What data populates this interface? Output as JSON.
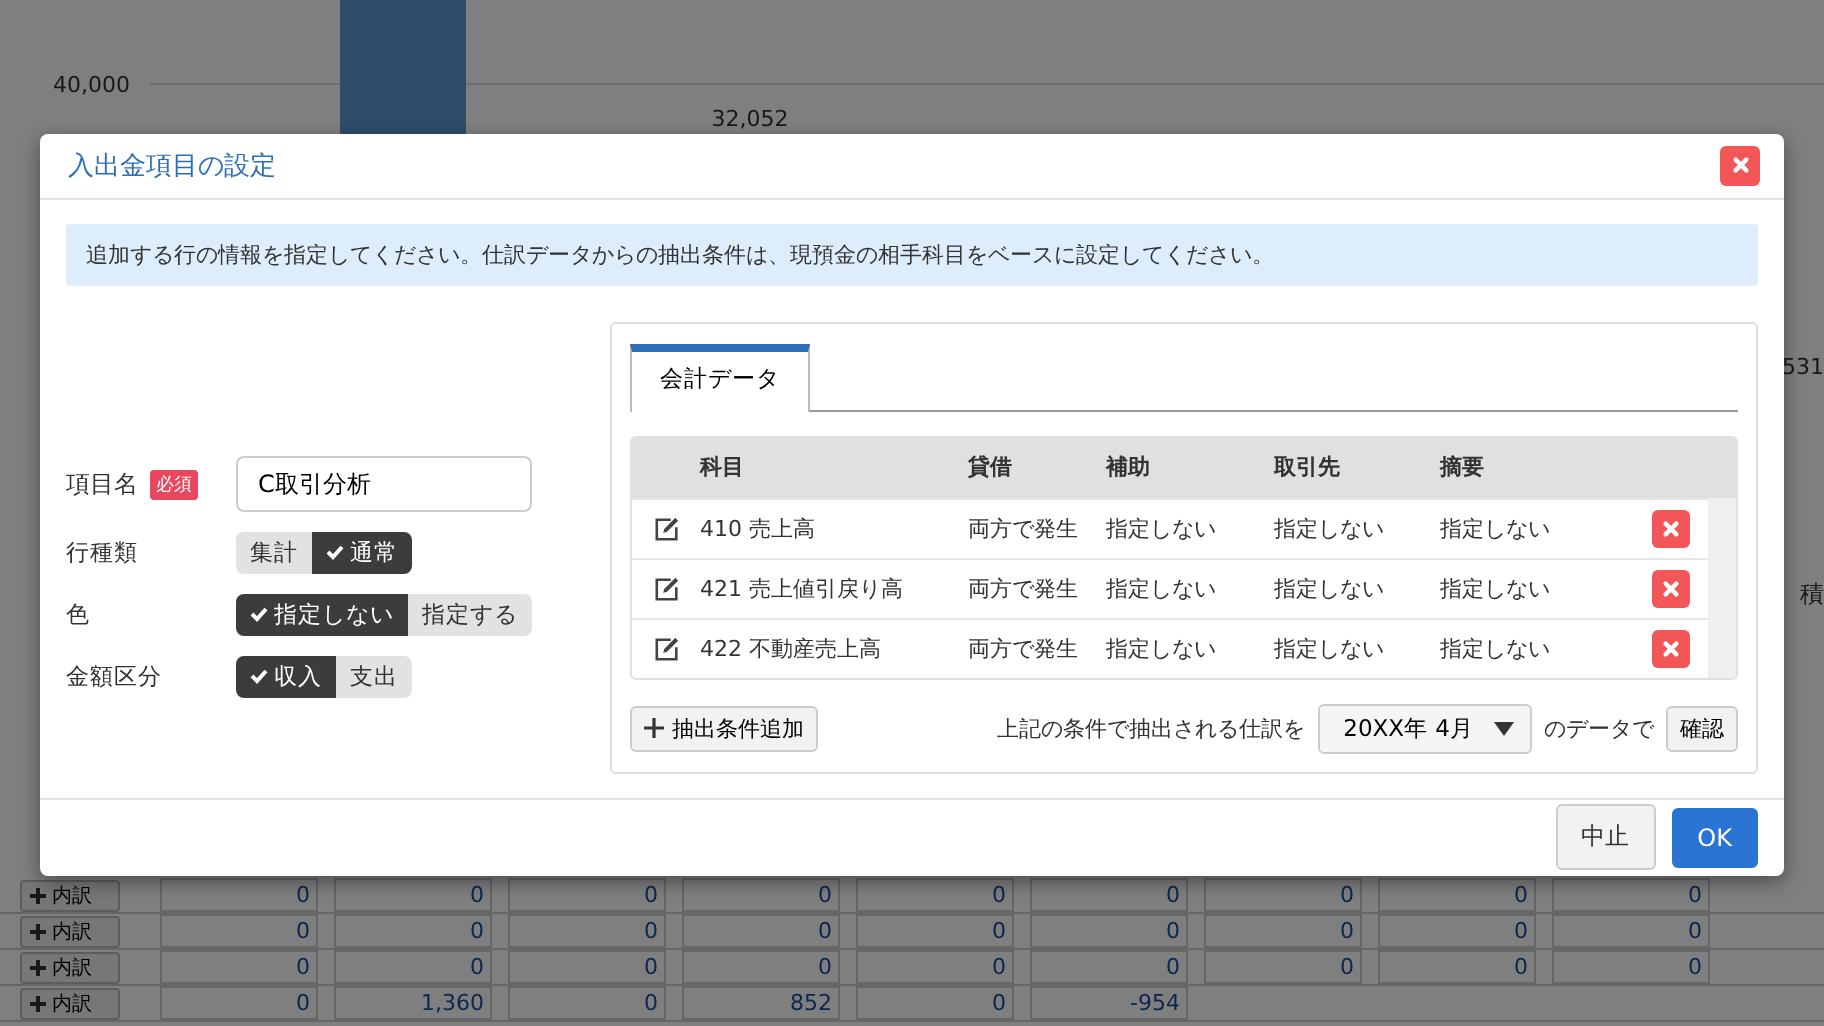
{
  "background": {
    "chart": {
      "tick_label": "40,000",
      "value_labels": [
        "32,052",
        "531"
      ]
    },
    "side_label": "積",
    "rows": [
      {
        "button": "内訳",
        "cells": [
          "0",
          "0",
          "0",
          "0",
          "0",
          "0",
          "0",
          "0",
          "0"
        ]
      },
      {
        "button": "内訳",
        "cells": [
          "0",
          "0",
          "0",
          "0",
          "0",
          "0",
          "0",
          "0",
          "0"
        ]
      },
      {
        "button": "内訳",
        "cells": [
          "0",
          "0",
          "0",
          "0",
          "0",
          "0",
          "0",
          "0",
          "0"
        ]
      },
      {
        "button": "内訳",
        "cells": [
          "0",
          "1,360",
          "0",
          "852",
          "0",
          "-954"
        ]
      }
    ]
  },
  "dialog": {
    "title": "入出金項目の設定",
    "info": "追加する行の情報を指定してください。仕訳データからの抽出条件は、現預金の相手科目をベースに設定してください。",
    "form": [
      {
        "kind": "text",
        "label": "項目名",
        "badge": "必須",
        "value": "C取引分析"
      },
      {
        "kind": "toggle",
        "label": "行種類",
        "options": [
          {
            "label": "集計",
            "selected": false
          },
          {
            "label": "通常",
            "selected": true
          }
        ]
      },
      {
        "kind": "toggle",
        "label": "色",
        "options": [
          {
            "label": "指定しない",
            "selected": true
          },
          {
            "label": "指定する",
            "selected": false
          }
        ]
      },
      {
        "kind": "toggle",
        "label": "金額区分",
        "options": [
          {
            "label": "収入",
            "selected": true
          },
          {
            "label": "支出",
            "selected": false
          }
        ]
      }
    ],
    "panel": {
      "tabs": [
        {
          "label": "会計データ",
          "selected": true
        }
      ],
      "columns": [
        "科目",
        "貸借",
        "補助",
        "取引先",
        "摘要"
      ],
      "rows": [
        {
          "cells": [
            "410 売上高",
            "両方で発生",
            "指定しない",
            "指定しない",
            "指定しない"
          ]
        },
        {
          "cells": [
            "421 売上値引戻り高",
            "両方で発生",
            "指定しない",
            "指定しない",
            "指定しない"
          ]
        },
        {
          "cells": [
            "422 不動産売上高",
            "両方で発生",
            "指定しない",
            "指定しない",
            "指定しない"
          ]
        }
      ],
      "add_button": "抽出条件追加",
      "period_prefix": "上記の条件で抽出される仕訳を",
      "period": "20XX年 4月",
      "period_suffix": "のデータで",
      "confirm_button": "確認"
    },
    "buttons": [
      {
        "label": "中止",
        "kind": "default"
      },
      {
        "label": "OK",
        "kind": "primary"
      }
    ]
  }
}
